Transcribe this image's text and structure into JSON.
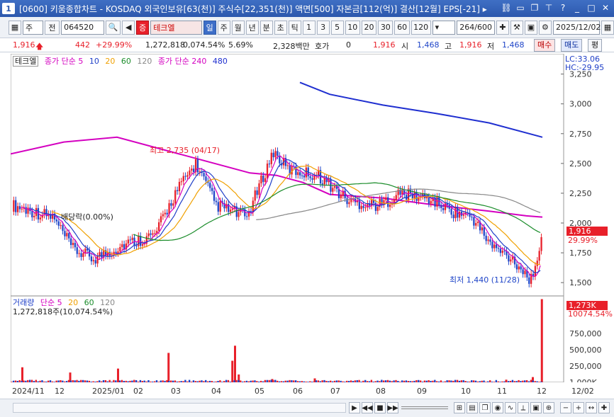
{
  "window": {
    "num": "1",
    "title": "[0600] 키움종합차트 - KOSDAQ 외국인보유[63(천)] 주식수[22,351(천)] 액면[500] 자본금[112(억)] 결산[12월] EPS[-21] ▸"
  },
  "toolbar": {
    "type": "주",
    "mode": "전",
    "code": "064520",
    "stock_badge": "증",
    "stock_name": "테크엘",
    "periods": [
      "일",
      "주",
      "월",
      "년",
      "분",
      "초",
      "틱"
    ],
    "intervals": [
      "1",
      "3",
      "5",
      "10",
      "20",
      "30",
      "60",
      "120"
    ],
    "count": "264/600",
    "date": "2025/12/02"
  },
  "quote": {
    "price": "1,916",
    "change": "442",
    "change_pct": "+29.99%",
    "volume": "1,272,818",
    "volume_ratio": "0,074.54%",
    "turnover": "5.69%",
    "amount": "2,328백만",
    "hoga_label": "호가",
    "hoga": "0",
    "hoga_price": "1,916",
    "open_label": "시",
    "open": "1,468",
    "high_label": "고",
    "high": "1,916",
    "low_label": "저",
    "low": "1,468",
    "buy": "매수",
    "sell": "매도",
    "eval": "평"
  },
  "chart_data": [
    {
      "type": "candlestick",
      "title": "테크엘",
      "legend": [
        {
          "name": "종가 단순 5",
          "color": "#d400c0"
        },
        {
          "name": "10",
          "color": "#1f3fc8"
        },
        {
          "name": "20",
          "color": "#f0a000"
        },
        {
          "name": "60",
          "color": "#1a8c2a"
        },
        {
          "name": "120",
          "color": "#888888"
        },
        {
          "name": "종가 단순 240",
          "color": "#d400c0"
        },
        {
          "name": "480",
          "color": "#1f2fd0"
        }
      ],
      "yticks": [
        "3,250",
        "3,000",
        "2,750",
        "2,500",
        "2,250",
        "2,000",
        "1,750",
        "1,500"
      ],
      "ylim": [
        1400,
        3420
      ],
      "lc_label": "LC:33.06",
      "hc_label": "HC:-29.95",
      "last_price": "1,916",
      "last_pct": "29.99%",
      "annotations": {
        "high": "최고 2,735 (04/17)",
        "low": "최저 1,440 (11/28)",
        "dividend": "배당락(0.00%)"
      },
      "ma240": {
        "x": [
          0,
          0.1,
          0.2,
          0.3,
          0.4,
          0.45,
          0.5,
          0.55,
          0.6,
          0.7,
          0.8,
          0.9,
          0.97,
          1.0
        ],
        "y": [
          2580,
          2680,
          2720,
          2600,
          2480,
          2420,
          2400,
          2340,
          2240,
          2210,
          2150,
          2100,
          2060,
          2050
        ]
      },
      "ma480": {
        "x": [
          0.544,
          0.6,
          0.7,
          0.8,
          0.9,
          1.0
        ],
        "y": [
          3180,
          3080,
          2990,
          2920,
          2840,
          2720
        ]
      },
      "highlights": [
        {
          "label": "1,916",
          "color": "#e8202a"
        }
      ]
    },
    {
      "type": "bar",
      "title": "거래량",
      "legend": [
        {
          "name": "단순 5",
          "color": "#d400c0"
        },
        {
          "name": "20",
          "color": "#f0a000"
        },
        {
          "name": "60",
          "color": "#1a8c2a"
        },
        {
          "name": "120",
          "color": "#888888"
        }
      ],
      "value_label": "1,272,818주(10,074.54%)",
      "yticks": [
        "1,000K",
        "750,000",
        "500,000",
        "250,000"
      ],
      "ylim": [
        0,
        1300000
      ],
      "last_label": "1,273K",
      "last_pct": "10074.54%",
      "bars": [
        {
          "x": 0.02,
          "v": 230000
        },
        {
          "x": 0.11,
          "v": 150000
        },
        {
          "x": 0.2,
          "v": 210000
        },
        {
          "x": 0.295,
          "v": 450000
        },
        {
          "x": 0.415,
          "v": 330000
        },
        {
          "x": 0.42,
          "v": 560000
        },
        {
          "x": 0.427,
          "v": 120000
        },
        {
          "x": 0.49,
          "v": 50000
        },
        {
          "x": 0.57,
          "v": 60000
        },
        {
          "x": 0.93,
          "v": 40000
        },
        {
          "x": 0.98,
          "v": 80000
        },
        {
          "x": 0.997,
          "v": 1272818
        }
      ]
    }
  ],
  "xaxis": [
    "2024/11",
    "12",
    "2025/01",
    "02",
    "03",
    "04",
    "05",
    "06",
    "07",
    "08",
    "09",
    "10",
    "11",
    "12",
    "12/02"
  ]
}
